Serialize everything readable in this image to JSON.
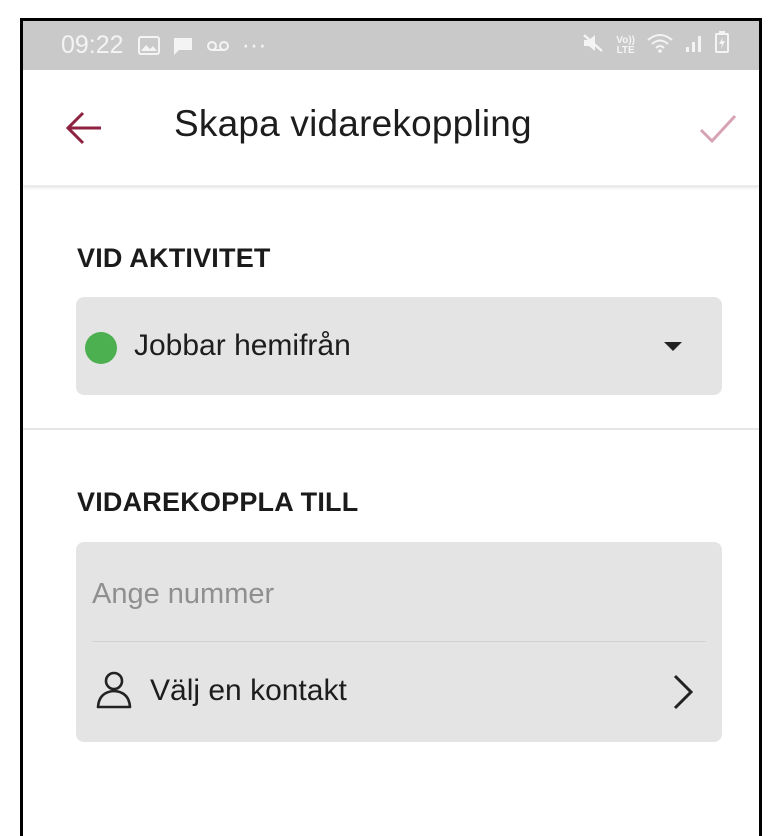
{
  "status_bar": {
    "time": "09:22",
    "icons": [
      "image-icon",
      "chat-icon",
      "voicemail-icon",
      "more-icon",
      "mute-icon",
      "volte-icon",
      "wifi-icon",
      "signal-icon",
      "battery-icon"
    ],
    "more_glyph": "···",
    "lte_top": "Vo))",
    "lte_bottom": "LTE"
  },
  "app_bar": {
    "title": "Skapa vidarekoppling",
    "back_icon": "arrow-left-icon",
    "confirm_icon": "checkmark-icon"
  },
  "activity_section": {
    "heading": "VID AKTIVITET",
    "selected_value": "Jobbar hemifrån",
    "status_color": "#4caf50"
  },
  "forward_section": {
    "heading": "VIDAREKOPPLA TILL",
    "number_placeholder": "Ange nummer",
    "number_value": "",
    "contact_label": "Välj en kontakt"
  },
  "colors": {
    "accent": "#8e2240",
    "confirm_disabled": "#d7a3b2",
    "status_bar": "#c9c9c9",
    "field_background": "#e4e4e4"
  }
}
